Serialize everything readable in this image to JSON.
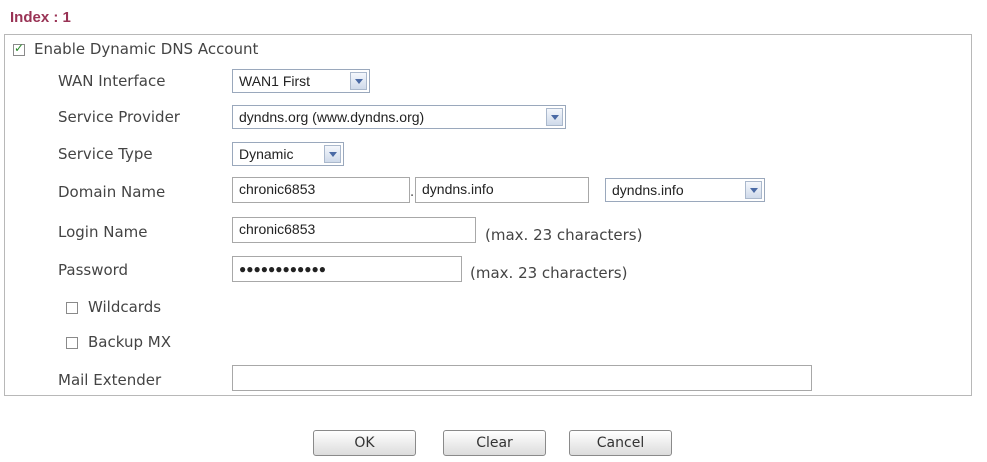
{
  "index_label": "Index : 1",
  "enable_ddns": {
    "label": "Enable Dynamic DNS Account",
    "checked": true
  },
  "wan_interface": {
    "label": "WAN Interface",
    "value": "WAN1 First"
  },
  "service_provider": {
    "label": "Service Provider",
    "value": "dyndns.org (www.dyndns.org)"
  },
  "service_type": {
    "label": "Service Type",
    "value": "Dynamic"
  },
  "domain_name": {
    "label": "Domain Name",
    "host": "chronic6853",
    "separator": ".",
    "domain": "dyndns.info",
    "domain_select": "dyndns.info"
  },
  "login_name": {
    "label": "Login Name",
    "value": "chronic6853",
    "hint": "(max. 23 characters)"
  },
  "password": {
    "label": "Password",
    "value": "●●●●●●●●●●●●",
    "hint": "(max. 23 characters)"
  },
  "wildcards": {
    "label": "Wildcards",
    "checked": false
  },
  "backup_mx": {
    "label": "Backup MX",
    "checked": false
  },
  "mail_extender": {
    "label": "Mail Extender",
    "value": ""
  },
  "buttons": {
    "ok": "OK",
    "clear": "Clear",
    "cancel": "Cancel"
  },
  "colors": {
    "index_title": "#993355",
    "check_mark": "#2a8a2a",
    "select_arrow": "#4a6aa5"
  }
}
